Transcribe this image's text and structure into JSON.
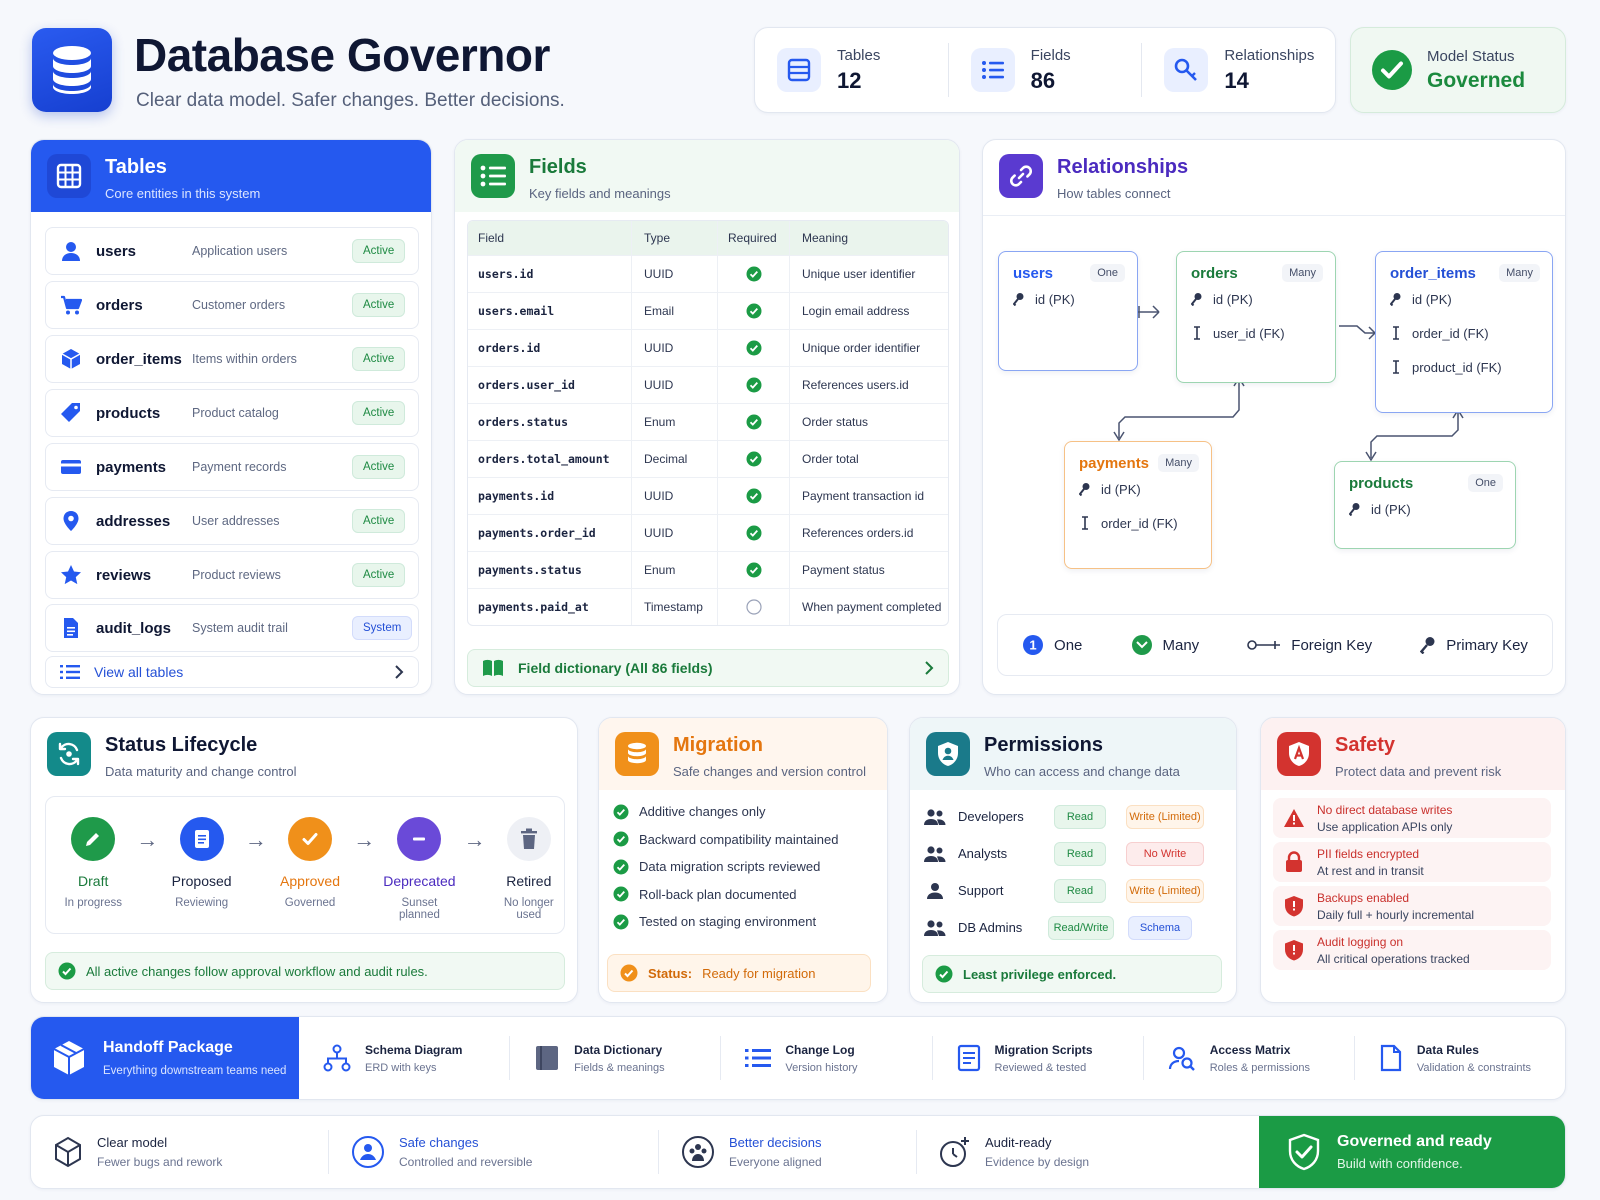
{
  "header": {
    "title": "Database Governor",
    "subtitle": "Clear data model. Safer changes. Better decisions.",
    "stats": [
      {
        "label": "Tables",
        "value": "12",
        "icon": "table-icon"
      },
      {
        "label": "Fields",
        "value": "86",
        "icon": "list-icon"
      },
      {
        "label": "Relationships",
        "value": "14",
        "icon": "key-icon"
      }
    ],
    "model_status": {
      "label": "Model Status",
      "value": "Governed"
    }
  },
  "tables": {
    "title": "Tables",
    "subtitle": "Core entities in this system",
    "items": [
      {
        "name": "users",
        "desc": "Application users",
        "badge": "Active",
        "icon": "user-icon"
      },
      {
        "name": "orders",
        "desc": "Customer orders",
        "badge": "Active",
        "icon": "cart-icon"
      },
      {
        "name": "order_items",
        "desc": "Items within orders",
        "badge": "Active",
        "icon": "cube-icon"
      },
      {
        "name": "products",
        "desc": "Product catalog",
        "badge": "Active",
        "icon": "tag-icon"
      },
      {
        "name": "payments",
        "desc": "Payment records",
        "badge": "Active",
        "icon": "card-icon"
      },
      {
        "name": "addresses",
        "desc": "User addresses",
        "badge": "Active",
        "icon": "pin-icon"
      },
      {
        "name": "reviews",
        "desc": "Product reviews",
        "badge": "Active",
        "icon": "star-icon"
      },
      {
        "name": "audit_logs",
        "desc": "System audit trail",
        "badge": "System",
        "icon": "file-icon"
      }
    ],
    "view_all": "View all tables"
  },
  "fields": {
    "title": "Fields",
    "subtitle": "Key fields and meanings",
    "columns": [
      "Field",
      "Type",
      "Required",
      "Meaning"
    ],
    "rows": [
      {
        "field": "users.id",
        "type": "UUID",
        "required": true,
        "meaning": "Unique user identifier"
      },
      {
        "field": "users.email",
        "type": "Email",
        "required": true,
        "meaning": "Login email address"
      },
      {
        "field": "orders.id",
        "type": "UUID",
        "required": true,
        "meaning": "Unique order identifier"
      },
      {
        "field": "orders.user_id",
        "type": "UUID",
        "required": true,
        "meaning": "References users.id"
      },
      {
        "field": "orders.status",
        "type": "Enum",
        "required": true,
        "meaning": "Order status"
      },
      {
        "field": "orders.total_amount",
        "type": "Decimal",
        "required": true,
        "meaning": "Order total"
      },
      {
        "field": "payments.id",
        "type": "UUID",
        "required": true,
        "meaning": "Payment transaction id"
      },
      {
        "field": "payments.order_id",
        "type": "UUID",
        "required": true,
        "meaning": "References orders.id"
      },
      {
        "field": "payments.status",
        "type": "Enum",
        "required": true,
        "meaning": "Payment status"
      },
      {
        "field": "payments.paid_at",
        "type": "Timestamp",
        "required": false,
        "meaning": "When payment completed"
      }
    ],
    "dictionary_link": "Field dictionary (All 86 fields)"
  },
  "relationships": {
    "title": "Relationships",
    "subtitle": "How tables connect",
    "entities": {
      "users": {
        "name": "users",
        "card": "One",
        "fields": [
          "id (PK)"
        ]
      },
      "orders": {
        "name": "orders",
        "card": "Many",
        "fields": [
          "id (PK)",
          "user_id (FK)"
        ]
      },
      "order_items": {
        "name": "order_items",
        "card": "Many",
        "fields": [
          "id (PK)",
          "order_id (FK)",
          "product_id (FK)"
        ]
      },
      "payments": {
        "name": "payments",
        "card": "Many",
        "fields": [
          "id (PK)",
          "order_id (FK)"
        ]
      },
      "products": {
        "name": "products",
        "card": "One",
        "fields": [
          "id (PK)"
        ]
      }
    },
    "legend": {
      "one": "One",
      "many": "Many",
      "fk": "Foreign Key",
      "pk": "Primary Key",
      "one_marker": "1"
    }
  },
  "lifecycle": {
    "title": "Status Lifecycle",
    "subtitle": "Data maturity and change control",
    "stages": [
      {
        "name": "Draft",
        "sub": "In progress",
        "color": "#1f9a4a"
      },
      {
        "name": "Proposed",
        "sub": "Reviewing",
        "color": "#2559ef"
      },
      {
        "name": "Approved",
        "sub": "Governed",
        "color": "#f0901a"
      },
      {
        "name": "Deprecated",
        "sub": "Sunset planned",
        "color": "#6a4ad8"
      },
      {
        "name": "Retired",
        "sub": "No longer used",
        "color": "#5d6682"
      }
    ],
    "note": "All active changes follow approval workflow and audit rules."
  },
  "migration": {
    "title": "Migration",
    "subtitle": "Safe changes and version control",
    "items": [
      "Additive changes only",
      "Backward compatibility maintained",
      "Data migration scripts reviewed",
      "Roll-back plan documented",
      "Tested on staging environment"
    ],
    "status_label": "Status:",
    "status_value": "Ready for migration"
  },
  "permissions": {
    "title": "Permissions",
    "subtitle": "Who can access and change data",
    "roles": [
      {
        "name": "Developers",
        "read": "Read",
        "write": "Write (Limited)"
      },
      {
        "name": "Analysts",
        "read": "Read",
        "write": "No Write"
      },
      {
        "name": "Support",
        "read": "Read",
        "write": "Write (Limited)"
      },
      {
        "name": "DB Admins",
        "read": "Read/Write",
        "write": "Schema"
      }
    ],
    "note": "Least privilege enforced."
  },
  "safety": {
    "title": "Safety",
    "subtitle": "Protect data and prevent risk",
    "items": [
      {
        "title": "No direct database writes",
        "sub": "Use application APIs only"
      },
      {
        "title": "PII fields encrypted",
        "sub": "At rest and in transit"
      },
      {
        "title": "Backups enabled",
        "sub": "Daily full + hourly incremental"
      },
      {
        "title": "Audit logging on",
        "sub": "All critical operations tracked"
      }
    ]
  },
  "handoff": {
    "title": "Handoff Package",
    "subtitle": "Everything downstream teams need",
    "items": [
      {
        "title": "Schema Diagram",
        "sub": "ERD with keys"
      },
      {
        "title": "Data Dictionary",
        "sub": "Fields & meanings"
      },
      {
        "title": "Change Log",
        "sub": "Version history"
      },
      {
        "title": "Migration Scripts",
        "sub": "Reviewed & tested"
      },
      {
        "title": "Access Matrix",
        "sub": "Roles & permissions"
      },
      {
        "title": "Data Rules",
        "sub": "Validation & constraints"
      }
    ]
  },
  "footer": {
    "items": [
      {
        "title": "Clear model",
        "sub": "Fewer bugs and rework"
      },
      {
        "title": "Safe changes",
        "sub": "Controlled and reversible"
      },
      {
        "title": "Better decisions",
        "sub": "Everyone aligned"
      },
      {
        "title": "Audit-ready",
        "sub": "Evidence by design"
      }
    ],
    "ready_title": "Governed and ready",
    "ready_sub": "Build with confidence."
  },
  "colors": {
    "primary": "#2559ef",
    "success": "#1b9b45",
    "warning": "#f0901a",
    "danger": "#d3332f",
    "purple": "#5a3ad0"
  }
}
